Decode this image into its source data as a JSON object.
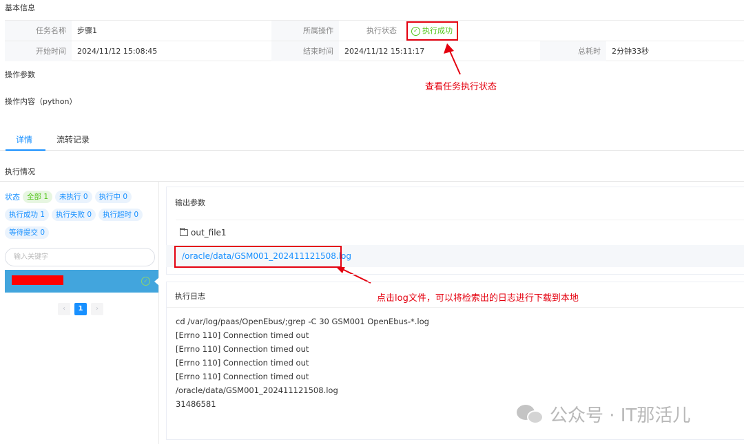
{
  "basic_info": {
    "title": "基本信息",
    "task_name_label": "任务名称",
    "task_name_value": "步骤1",
    "operation_label": "所属操作",
    "exec_status_label": "执行状态",
    "exec_status_value": "执行成功",
    "start_time_label": "开始时间",
    "start_time_value": "2024/11/12 15:08:45",
    "end_time_label": "结束时间",
    "end_time_value": "2024/11/12 15:11:17",
    "duration_label": "总耗时",
    "duration_value": "2分钟33秒"
  },
  "annotations": {
    "status_note": "查看任务执行状态",
    "log_note": "点击log文件，可以将检索出的日志进行下载到本地"
  },
  "params": {
    "title": "操作参数",
    "content_title": "操作内容（python）"
  },
  "tabs": [
    {
      "label": "详情",
      "active": true
    },
    {
      "label": "流转记录",
      "active": false
    }
  ],
  "execution": {
    "title": "执行情况",
    "filter_label": "状态",
    "filters": [
      {
        "label": "全部 1",
        "active": true
      },
      {
        "label": "未执行 0",
        "active": false
      },
      {
        "label": "执行中 0",
        "active": false
      },
      {
        "label": "执行成功 1",
        "active": false
      },
      {
        "label": "执行失败 0",
        "active": false
      },
      {
        "label": "执行超时 0",
        "active": false
      },
      {
        "label": "等待提交 0",
        "active": false
      }
    ],
    "search_placeholder": "输入关键字",
    "pager": {
      "prev": "‹",
      "current": "1",
      "next": "›"
    }
  },
  "output": {
    "title": "输出参数",
    "folder_name": "out_file1",
    "file_link": "/oracle/data/GSM001_202411121508.log"
  },
  "log": {
    "title": "执行日志",
    "lines": [
      "cd /var/log/paas/OpenEbus/;grep -C 30 GSM001 OpenEbus-*.log",
      "[Errno 110] Connection timed out",
      "[Errno 110] Connection timed out",
      "[Errno 110] Connection timed out",
      "[Errno 110] Connection timed out",
      "/oracle/data/GSM001_202411121508.log",
      "31486581"
    ]
  },
  "watermark": {
    "text": "公众号 · IT那活儿"
  },
  "colors": {
    "accent": "#1890ff",
    "success": "#52c41a",
    "annotation_red": "#e4000f",
    "selected_row": "#42a5dd"
  }
}
